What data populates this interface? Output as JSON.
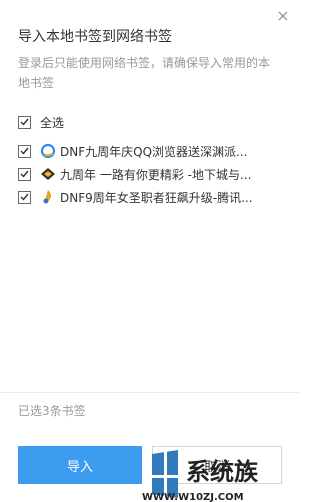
{
  "dialog": {
    "title": "导入本地书签到网络书签",
    "subtitle": "登录后只能使用网络书签，请确保导入常用的本地书签",
    "select_all_label": "全选",
    "bookmarks": [
      {
        "label": "DNF九周年庆QQ浏览器送深渊派...",
        "icon": "qq-browser-icon",
        "checked": true
      },
      {
        "label": "九周年 一路有你更精彩 -地下城与...",
        "icon": "dnf-game-icon",
        "checked": true
      },
      {
        "label": "DNF9周年女圣职者狂飙升级-腾讯...",
        "icon": "tencent-game-icon",
        "checked": true
      }
    ],
    "selected_count_text": "已选3条书签",
    "import_label": "导入",
    "cancel_label": "取消"
  },
  "watermark": {
    "brand": "系统族",
    "site": "WWW.W10ZJ.COM"
  },
  "colors": {
    "accent": "#3b9cf0",
    "title_text": "#333333",
    "muted_text": "#999999"
  }
}
